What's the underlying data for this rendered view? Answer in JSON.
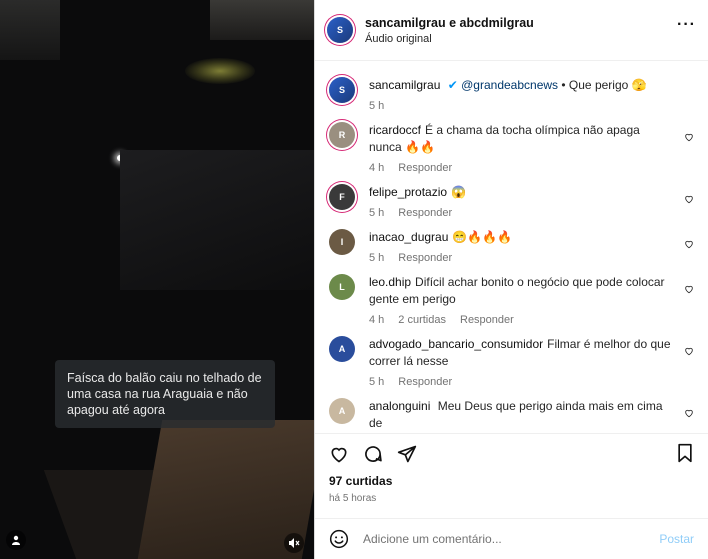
{
  "video": {
    "caption": "Faísca do balão caiu no telhado de uma casa na rua Araguaia e não apagou até agora"
  },
  "header": {
    "authors": "sancamilgrau e abcdmilgrau",
    "audio": "Áudio original",
    "more_icon": "more-horizontal-icon"
  },
  "post": {
    "user": "sancamilgrau",
    "mention": "@grandeabcnews",
    "text": "• Que perigo 🫣",
    "time": "5 h"
  },
  "comments": [
    {
      "user": "ricardoccf",
      "text": "É a chama da tocha olímpica não apaga nunca 🔥🔥",
      "time": "4 h",
      "likes": "",
      "reply": "Responder"
    },
    {
      "user": "felipe_protazio",
      "text": "😱",
      "time": "5 h",
      "likes": "",
      "reply": "Responder"
    },
    {
      "user": "inacao_dugrau",
      "text": "😁🔥🔥🔥",
      "time": "5 h",
      "likes": "",
      "reply": "Responder"
    },
    {
      "user": "leo.dhip",
      "text": "Difícil achar bonito o negócio que pode colocar gente em perigo",
      "time": "4 h",
      "likes": "2 curtidas",
      "reply": "Responder"
    },
    {
      "user": "advogado_bancario_consumidor",
      "text": "Filmar é melhor do que correr lá nesse",
      "time": "5 h",
      "likes": "",
      "reply": "Responder"
    },
    {
      "user": "analonguini",
      "text": "Meu Deus que perigo ainda mais em cima de",
      "time": "",
      "likes": "",
      "reply": ""
    }
  ],
  "actions": {
    "likes": "97 curtidas",
    "ago": "há 5 horas"
  },
  "add_comment": {
    "placeholder": "Adicione um comentário...",
    "post": "Postar"
  },
  "colors": {
    "mention": "#00376b",
    "story_ring": "#d62976",
    "post_button": "#90cdf8"
  }
}
